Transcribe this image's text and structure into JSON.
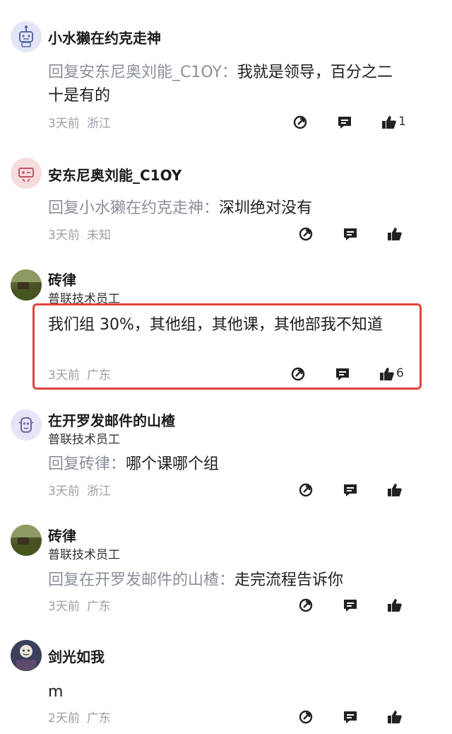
{
  "comments": [
    {
      "name": "小水獭在约克走神",
      "reply_prefix": "回复安东尼奥刘能_C1OY：",
      "reply_text": "我就是领导，百分之二十是有的",
      "time": "3天前",
      "location": "浙江",
      "likes": "1"
    },
    {
      "name": "安东尼奥刘能_C1OY",
      "reply_prefix": "回复小水獭在约克走神：",
      "reply_text": "深圳绝对没有",
      "time": "3天前",
      "location": "未知",
      "likes": ""
    },
    {
      "name": "砖律",
      "role": "普联技术员工",
      "text": "我们组 30%，其他组，其他课，其他部我不知道",
      "time": "3天前",
      "location": "广东",
      "likes": "6"
    },
    {
      "name": "在开罗发邮件的山楂",
      "role": "普联技术员工",
      "reply_prefix": "回复砖律：",
      "reply_text": "哪个课哪个组",
      "time": "3天前",
      "location": "浙江",
      "likes": ""
    },
    {
      "name": "砖律",
      "role": "普联技术员工",
      "reply_prefix": "回复在开罗发邮件的山楂：",
      "reply_text": "走完流程告诉你",
      "time": "3天前",
      "location": "广东",
      "likes": ""
    },
    {
      "name": "剑光如我",
      "text": "m",
      "time": "2天前",
      "location": "广东",
      "likes": ""
    }
  ],
  "icons": {
    "share": "share-icon",
    "comment": "comment-icon",
    "like": "thumbs-up-icon"
  },
  "colors": {
    "highlight_border": "#e0443a",
    "meta_text": "#9aa0a8",
    "reply_prefix": "#8a8f99"
  }
}
